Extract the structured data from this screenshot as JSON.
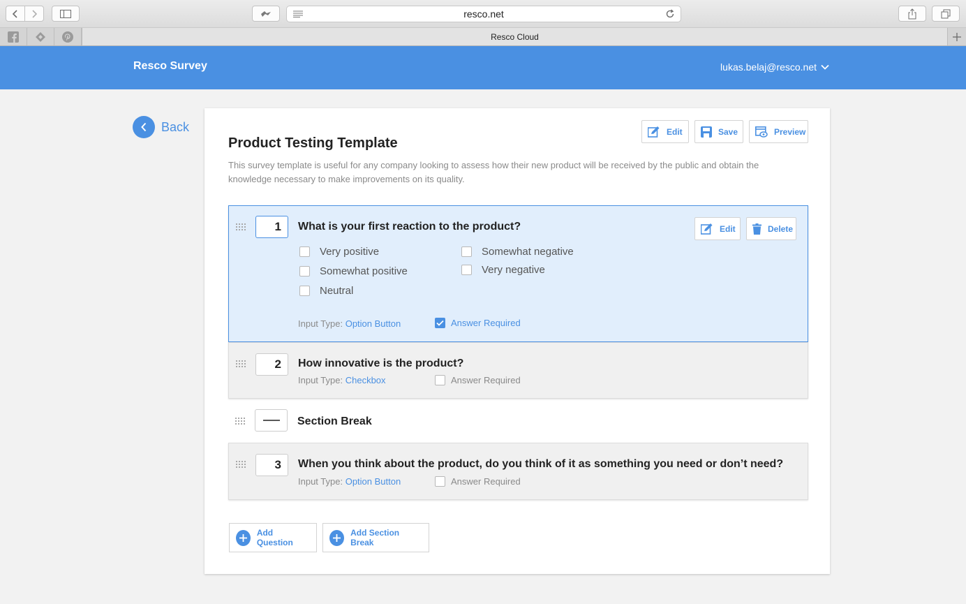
{
  "browser": {
    "url": "resco.net",
    "tab_title": "Resco Cloud"
  },
  "app": {
    "title": "Resco Survey",
    "user": "lukas.belaj@resco.net",
    "back_label": "Back"
  },
  "survey": {
    "title": "Product Testing Template",
    "description": "This survey template is useful for any company looking to assess how their new product will be received by the public and obtain the knowledge necessary to make improvements on its quality.",
    "actions": {
      "edit": "Edit",
      "save": "Save",
      "preview": "Preview"
    }
  },
  "questions": [
    {
      "number": "1",
      "text": "What is your first reaction to the product?",
      "options": [
        "Very positive",
        "Somewhat positive",
        "Neutral",
        "Somewhat negative",
        "Very negative"
      ],
      "input_type_label": "Input Type:",
      "input_type": "Option Button",
      "required_label": "Answer Required",
      "required": true,
      "edit_label": "Edit",
      "delete_label": "Delete"
    },
    {
      "number": "2",
      "text": "How innovative is the product?",
      "input_type_label": "Input Type:",
      "input_type": "Checkbox",
      "required_label": "Answer Required",
      "required": false
    },
    {
      "number": "3",
      "text": "When you think about the product, do you think of it as something you need or don’t need?",
      "input_type_label": "Input Type:",
      "input_type": "Option Button",
      "required_label": "Answer Required",
      "required": false
    }
  ],
  "section_break": {
    "label": "Section Break"
  },
  "add": {
    "question": "Add Question",
    "section_break": "Add Section Break"
  },
  "colors": {
    "accent": "#4a90e2",
    "active_bg": "#e1eefc"
  }
}
